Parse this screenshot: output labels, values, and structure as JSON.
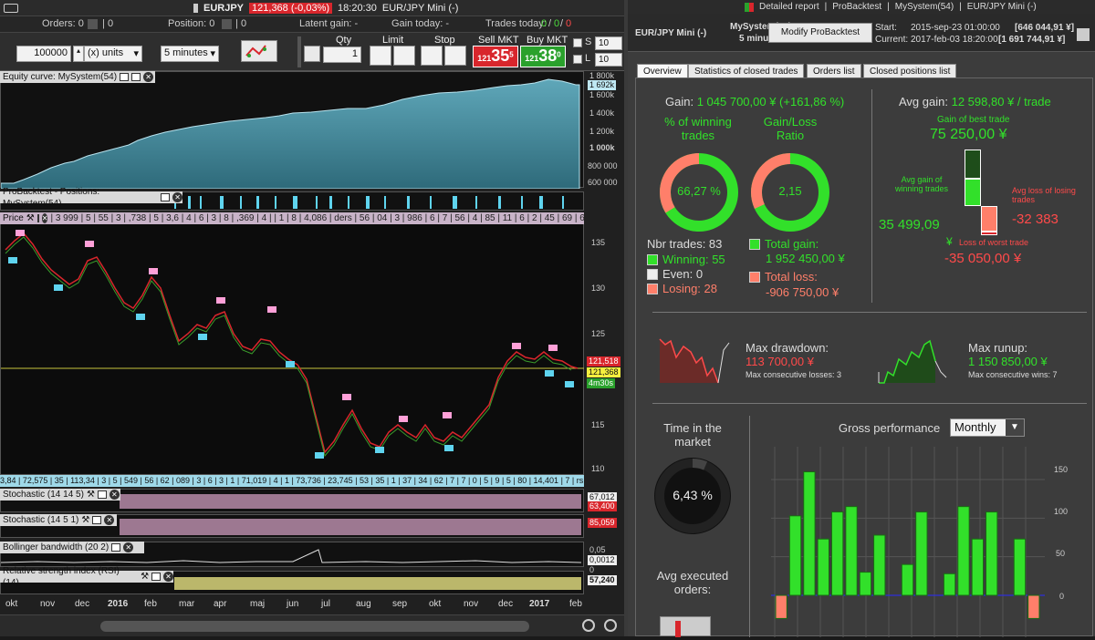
{
  "left": {
    "topbar": {
      "instrument": "EURJPY",
      "price_change": "121,368 (-0,03%)",
      "time": "18:20:30",
      "title": "EUR/JPY Mini (-)"
    },
    "bar2": {
      "orders": "Orders: 0",
      "orders_count": "0",
      "position": "Position: 0",
      "position_count": "0",
      "latent_gain": "Latent gain: -",
      "gain_today": "Gain today: -",
      "trades_today_label": "Trades today:",
      "trades_today_a": "0",
      "trades_today_b": "0",
      "trades_today_c": "0"
    },
    "toolbar": {
      "units_value": "100000",
      "units_label": "(x) units",
      "timeframe": "5 minutes",
      "qty_label": "Qty",
      "qty_value": "1",
      "limit_label": "Limit",
      "stop_label": "Stop",
      "sell_label": "Sell MKT",
      "buy_label": "Buy MKT",
      "sell_small": "121",
      "sell_big": "35",
      "sell_sup": "5",
      "buy_small": "121",
      "buy_big": "38",
      "buy_sup": "0",
      "s_label": "S",
      "l_label": "L",
      "s_value": "10",
      "l_value": "10"
    },
    "equity": {
      "title": "Equity curve: MySystem(54)",
      "current": "1 692k",
      "ticks": [
        "1 800k",
        "1 600k",
        "1 400k",
        "1 200k",
        "1 000k",
        "800 000",
        "600 000"
      ]
    },
    "positions_title": "ProBacktest - Positions: MySystem(54)",
    "price": {
      "title": "Price",
      "header_strip": "| 3 999 | 5 | 55 | 3 | ,738 | 5 | 3,6 | 4 | 6 | 3 | 8 | ,369 | 4 | | 1 | 8 | 4,086 | ders | 56 | 04 | 3 | 986 | 6 | 7 | 56 | 4 | 85 | 11 | 6 | 2 | 45 | 69 | 64 | 7 | 4,751 | 7 | 2 | ,180 | 7 | 3 | 7 | 22,444 | 75",
      "bottom_strip": "3,84 | 72,575 | 35 | 113,34 | 3 | 5 | 549 | 56 | 62 | 089 | 3 | 6 | 3 | 1 | 71,019 | 4 | 1 | 73,736 | 23,745 | 53 | 35 | 1 | 37 | 34 | 62 | 7 | 7 | 0 | 5 | 9 | 5 | 80 | 14,401 | 7 | rs | 7 | 52 | ders",
      "ticks": [
        "135",
        "130",
        "125",
        "120",
        "115",
        "110"
      ],
      "last_red": "121,518",
      "last_yellow": "121,368",
      "countdown": "4m30s"
    },
    "stoch1": {
      "title": "Stochastic (14 14 5)",
      "v1": "67,012",
      "v2": "63,400"
    },
    "stoch2": {
      "title": "Stochastic (14 5 1)",
      "v1": "85,059"
    },
    "bollinger": {
      "title": "Bollinger bandwidth (20 2)",
      "t1": "0,05",
      "t2": "0,0012",
      "t3": "0"
    },
    "rsi": {
      "title": "Relative strength index (RSI) (14)",
      "value": "57,240"
    },
    "months": [
      "okt",
      "nov",
      "dec",
      "2016",
      "feb",
      "mar",
      "apr",
      "maj",
      "jun",
      "jul",
      "aug",
      "sep",
      "okt",
      "nov",
      "dec",
      "2017",
      "feb"
    ]
  },
  "right": {
    "topbar": {
      "detailed": "Detailed report",
      "pb": "ProBacktest",
      "sys": "MySystem(54)",
      "inst": "EUR/JPY Mini (-)"
    },
    "head": {
      "instrument": "EUR/JPY Mini (-)",
      "system": "MySystem(54)",
      "timeframe": "5 minutes",
      "modify": "Modify ProBacktest",
      "start_label": "Start:",
      "start_date": "2015-sep-23 01:00:00",
      "start_value": "[646 044,91 ¥]",
      "current_label": "Current:",
      "current_date": "2017-feb-03 18:20:00",
      "current_value": "[1 691 744,91 ¥]"
    },
    "tabs": [
      "Overview",
      "Statistics of closed trades",
      "Orders list",
      "Closed positions list"
    ],
    "gain_label": "Gain:",
    "gain_value": "1 045 700,00 ¥ (+161,86 %)",
    "pct_winning_label": "% of winning trades",
    "pct_winning_value": "66,27 %",
    "gainloss_label": "Gain/Loss Ratio",
    "gainloss_value": "2,15",
    "nbr_trades": "Nbr trades: 83",
    "winning": "Winning: 55",
    "even": "Even: 0",
    "losing": "Losing: 28",
    "total_gain_label": "Total gain:",
    "total_gain_value": "1 952 450,00 ¥",
    "total_loss_label": "Total loss:",
    "total_loss_value": "-906 750,00 ¥",
    "avg_gain_label": "Avg gain:",
    "avg_gain_value": "12 598,80 ¥ / trade",
    "best_trade_label": "Gain of best trade",
    "best_trade_value": "75 250,00 ¥",
    "avg_win_label": "Avg gain of winning trades",
    "avg_win_value": "35 499,09",
    "avg_win_unit": "¥",
    "avg_loss_label": "Avg loss of losing trades",
    "avg_loss_value": "-32 383",
    "worst_label": "Loss of worst trade",
    "worst_value": "-35 050,00 ¥",
    "max_dd_label": "Max drawdown:",
    "max_dd_value": "113 700,00 ¥",
    "max_dd_sub": "Max consecutive losses: 3",
    "max_runup_label": "Max runup:",
    "max_runup_value": "1 150 850,00 ¥",
    "max_runup_sub": "Max consecutive wins: 7",
    "time_market_label": "Time in the market",
    "time_market_value": "6,43 %",
    "avg_exec_label": "Avg executed orders:",
    "gross_label": "Gross performance",
    "gross_mode": "Monthly",
    "gross_ticks": [
      "150",
      "100",
      "50",
      "0"
    ],
    "colors": {
      "green": "#32e02a",
      "red": "#ff5555",
      "salmon": "#ff7f6a"
    }
  },
  "chart_data": {
    "type": "bar",
    "title": "Gross performance",
    "ylim": [
      -30,
      170
    ],
    "values": [
      -30,
      103,
      160,
      73,
      108,
      115,
      30,
      78,
      0,
      40,
      108,
      0,
      28,
      115,
      73,
      108,
      0,
      73,
      -30
    ]
  }
}
